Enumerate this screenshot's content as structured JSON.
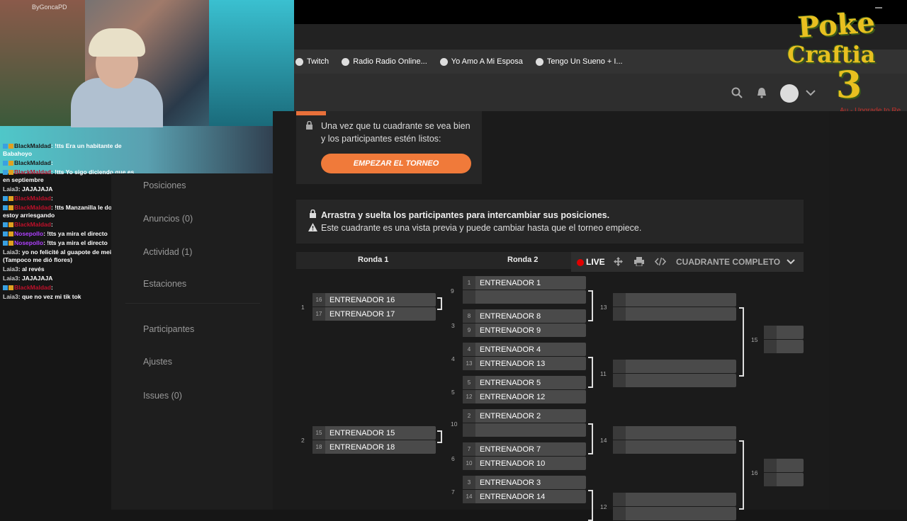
{
  "stream": {
    "handle": "ByGoncaPD",
    "logo": {
      "line1": "Poke",
      "line2": "Craftia",
      "line3": "3"
    },
    "chat": [
      {
        "user": "BlackMaldad",
        "user_color": "blk",
        "msg": ": !tts Era un habitante de Babahoyo"
      },
      {
        "user": "BlackMaldad",
        "user_color": "blk",
        "msg": ":"
      },
      {
        "user": "BlackMaldad",
        "user_color": "red",
        "msg": ": !tts Yo sigo diciendo que es en septiembre"
      },
      {
        "user": "Laia3",
        "user_color": "gry",
        "msg": ": JAJAJAJA"
      },
      {
        "user": "BlackMaldad",
        "user_color": "red",
        "msg": ":"
      },
      {
        "user": "BlackMaldad",
        "user_color": "red",
        "msg": ": !tts Manzanilla le doy y me estoy arriesgando"
      },
      {
        "user": "BlackMaldad",
        "user_color": "red",
        "msg": ":"
      },
      {
        "user": "Nosepollo",
        "user_color": "pur",
        "msg": ": !tts ya mira el directo"
      },
      {
        "user": "Nosepollo",
        "user_color": "pur",
        "msg": ": !tts ya mira el directo"
      },
      {
        "user": "Laia3",
        "user_color": "gry",
        "msg": ": yo no felicité al guapote de meim JAJAJA (Tampoco me dió flores)"
      },
      {
        "user": "Laia3",
        "user_color": "gry",
        "msg": ": al revés"
      },
      {
        "user": "Laia3",
        "user_color": "gry",
        "msg": ": JAJAJAJA"
      },
      {
        "user": "BlackMaldad",
        "user_color": "red",
        "msg": ":"
      },
      {
        "user": "Laia3",
        "user_color": "gry",
        "msg": ": que no vez mi tik tok"
      }
    ]
  },
  "bookmarks": [
    "Twitch",
    "Radio Radio Online...",
    "Yo Amo A Mi Esposa",
    "Tengo Un Sueno + I..."
  ],
  "header": {
    "upgrade_text": "Upgrade to Re",
    "prefix_text": "Au -"
  },
  "sidebar": {
    "items": [
      "Posiciones",
      "Anuncios (0)",
      "Actividad (1)",
      "Estaciones",
      "Participantes",
      "Ajustes",
      "Issues (0)"
    ]
  },
  "notice": {
    "text": "Una vez que tu cuadrante se vea bien y los participantes estén listos:",
    "button": "EMPEZAR EL TORNEO"
  },
  "info": {
    "line1": "Arrastra y suelta los participantes para intercambiar sus posiciones.",
    "line2": "Este cuadrante es una vista previa y puede cambiar hasta que el torneo empiece."
  },
  "toolbar": {
    "round1": "Ronda 1",
    "round2": "Ronda 2",
    "live": "LIVE",
    "full_bracket": "CUADRANTE COMPLETO"
  },
  "round1": [
    {
      "num": "1",
      "p1": {
        "seed": "16",
        "name": "ENTRENADOR 16"
      },
      "p2": {
        "seed": "17",
        "name": "ENTRENADOR 17"
      },
      "next": "9"
    },
    {
      "num": "2",
      "p1": {
        "seed": "15",
        "name": "ENTRENADOR 15"
      },
      "p2": {
        "seed": "18",
        "name": "ENTRENADOR 18"
      },
      "next": "10"
    }
  ],
  "round2": [
    {
      "num": "",
      "p1": {
        "seed": "1",
        "name": "ENTRENADOR 1"
      },
      "p2": {
        "seed": "",
        "name": ""
      }
    },
    {
      "num": "3",
      "p1": {
        "seed": "8",
        "name": "ENTRENADOR 8"
      },
      "p2": {
        "seed": "9",
        "name": "ENTRENADOR 9"
      }
    },
    {
      "num": "4",
      "p1": {
        "seed": "4",
        "name": "ENTRENADOR 4"
      },
      "p2": {
        "seed": "13",
        "name": "ENTRENADOR 13"
      }
    },
    {
      "num": "5",
      "p1": {
        "seed": "5",
        "name": "ENTRENADOR 5"
      },
      "p2": {
        "seed": "12",
        "name": "ENTRENADOR 12"
      }
    },
    {
      "num": "",
      "p1": {
        "seed": "2",
        "name": "ENTRENADOR 2"
      },
      "p2": {
        "seed": "",
        "name": ""
      }
    },
    {
      "num": "6",
      "p1": {
        "seed": "7",
        "name": "ENTRENADOR 7"
      },
      "p2": {
        "seed": "10",
        "name": "ENTRENADOR 10"
      }
    },
    {
      "num": "7",
      "p1": {
        "seed": "3",
        "name": "ENTRENADOR 3"
      },
      "p2": {
        "seed": "14",
        "name": "ENTRENADOR 14"
      }
    }
  ],
  "round3_labels": [
    "13",
    "11",
    "14",
    "12"
  ],
  "round4_labels": [
    "15",
    "16"
  ]
}
